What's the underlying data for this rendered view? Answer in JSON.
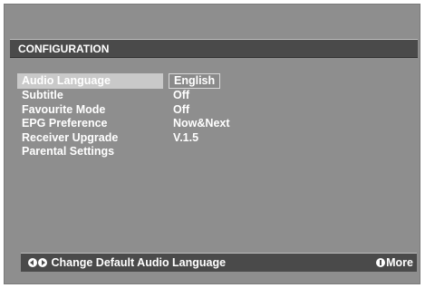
{
  "title": "CONFIGURATION",
  "menu": [
    {
      "label": "Audio Language",
      "value": "English",
      "selected": true
    },
    {
      "label": "Subtitle",
      "value": "Off"
    },
    {
      "label": "Favourite Mode",
      "value": "Off"
    },
    {
      "label": "EPG Preference",
      "value": "Now&Next"
    },
    {
      "label": "Receiver Upgrade",
      "value": "V.1.5"
    },
    {
      "label": "Parental Settings",
      "value": ""
    }
  ],
  "footer": {
    "hint": "Change Default Audio Language",
    "more": "More"
  },
  "icons": {
    "nav_left": "arrow-left-icon",
    "nav_right": "arrow-right-icon",
    "info": "info-icon"
  },
  "colors": {
    "background": "#8e8e8e",
    "bar": "#4a4a4a",
    "highlight": "#c9c9c9",
    "text": "#ffffff"
  }
}
